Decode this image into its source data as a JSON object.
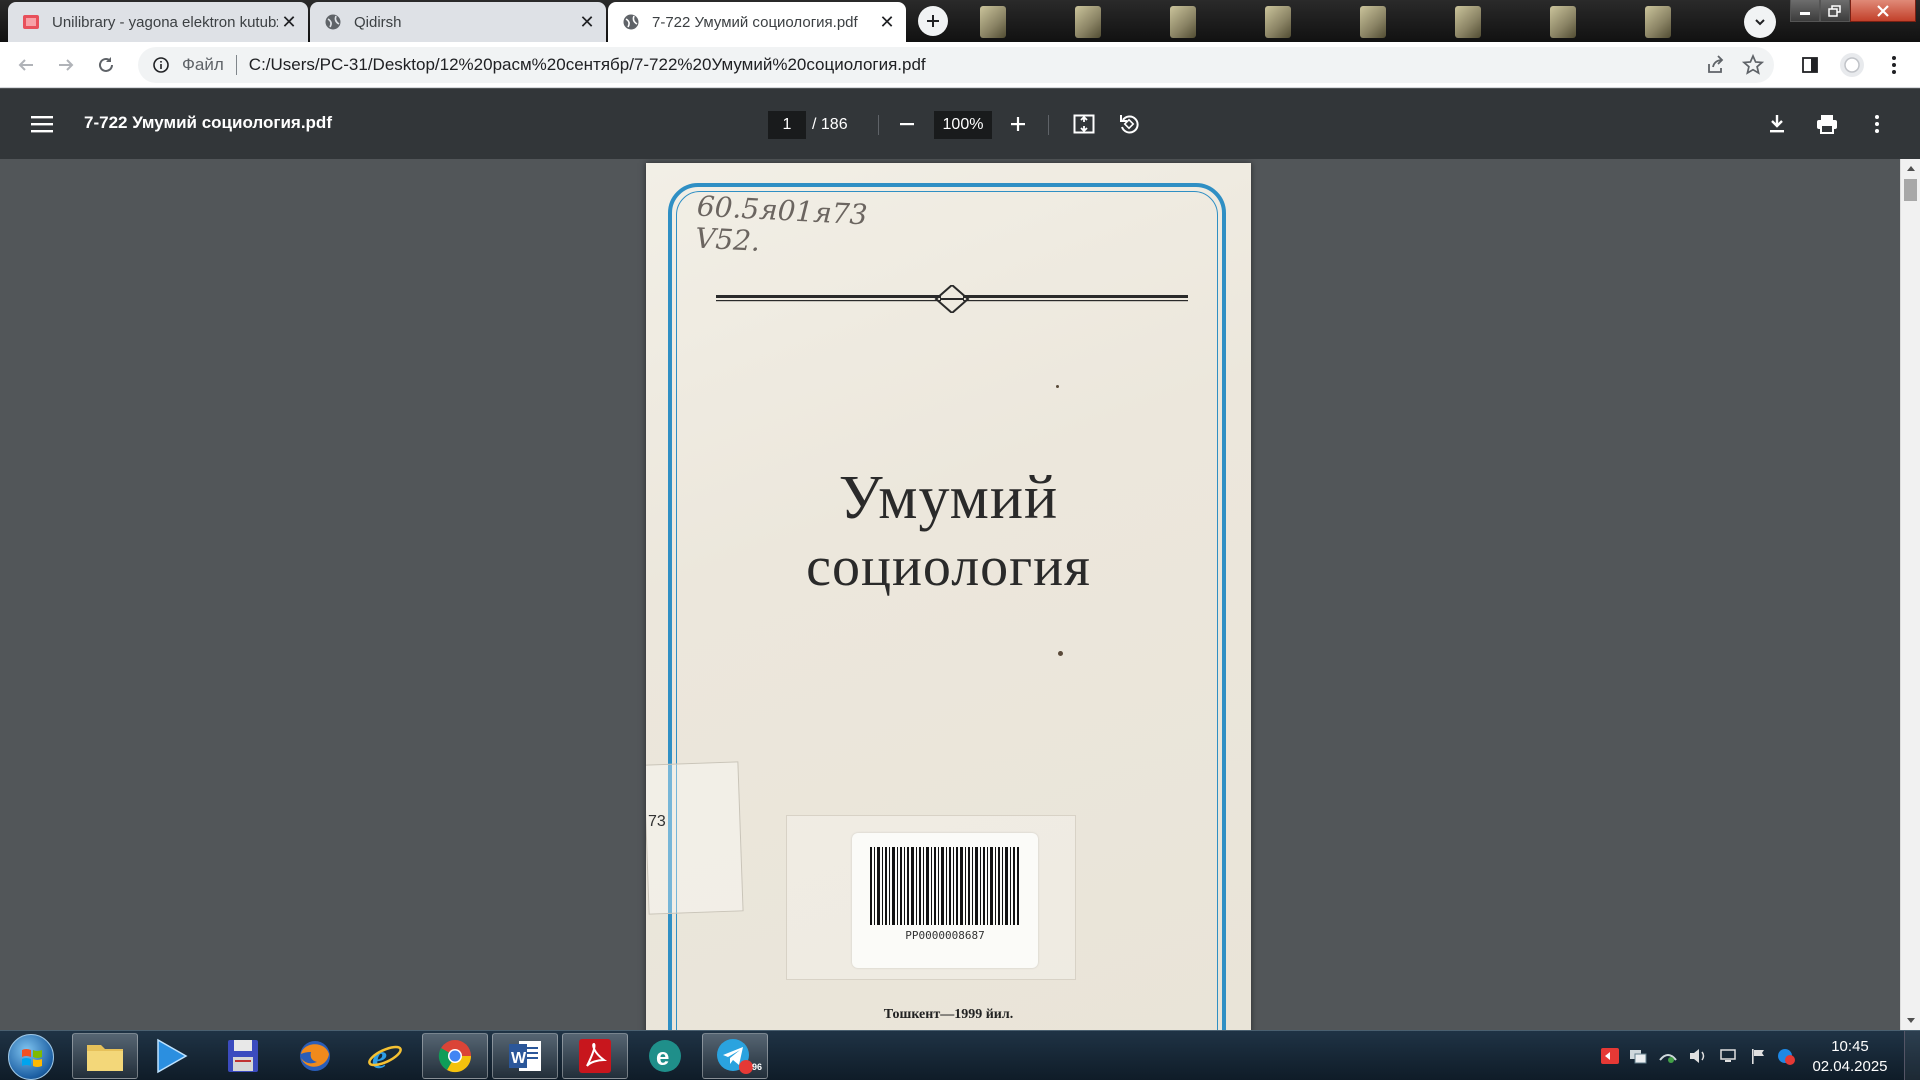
{
  "browser": {
    "tabs": [
      {
        "title": "Unilibrary - yagona elektron kutubxona",
        "favicon": "unilibrary-icon",
        "active": false
      },
      {
        "title": "Qidirsh",
        "favicon": "globe-icon",
        "active": false
      },
      {
        "title": "7-722 Умумий социология.pdf",
        "favicon": "globe-icon",
        "active": true
      }
    ],
    "omnibox": {
      "scheme_label": "Файл",
      "url": "C:/Users/PC-31/Desktop/12%20расм%20сентябр/7-722%20Умумий%20социология.pdf"
    }
  },
  "pdf_viewer": {
    "title": "7-722 Умумий социология.pdf",
    "current_page": "1",
    "page_total": "/ 186",
    "zoom": "100%"
  },
  "document": {
    "shelfmark": "60.5я01я73\nV52.",
    "title_line1": "Умумий",
    "title_line2": "социология",
    "spine_label_text": "73",
    "barcode_number": "PP0000008687",
    "publisher_line": "Тошкент—1999 йил."
  },
  "taskbar": {
    "apps": [
      {
        "name": "windows-explorer",
        "running": true
      },
      {
        "name": "media-player",
        "running": false
      },
      {
        "name": "save-app",
        "running": false
      },
      {
        "name": "firefox",
        "running": false
      },
      {
        "name": "internet-explorer",
        "running": false
      },
      {
        "name": "chrome",
        "running": true
      },
      {
        "name": "word",
        "running": true
      },
      {
        "name": "acrobat",
        "running": true
      },
      {
        "name": "e-app",
        "running": false
      },
      {
        "name": "telegram",
        "running": true
      }
    ],
    "telegram_badge": "96",
    "clock_time": "10:45",
    "clock_date": "02.04.2025"
  },
  "colors": {
    "pdf_toolbar": "#323639",
    "viewer_bg": "#525659",
    "cover_border": "#2f8fc4"
  }
}
